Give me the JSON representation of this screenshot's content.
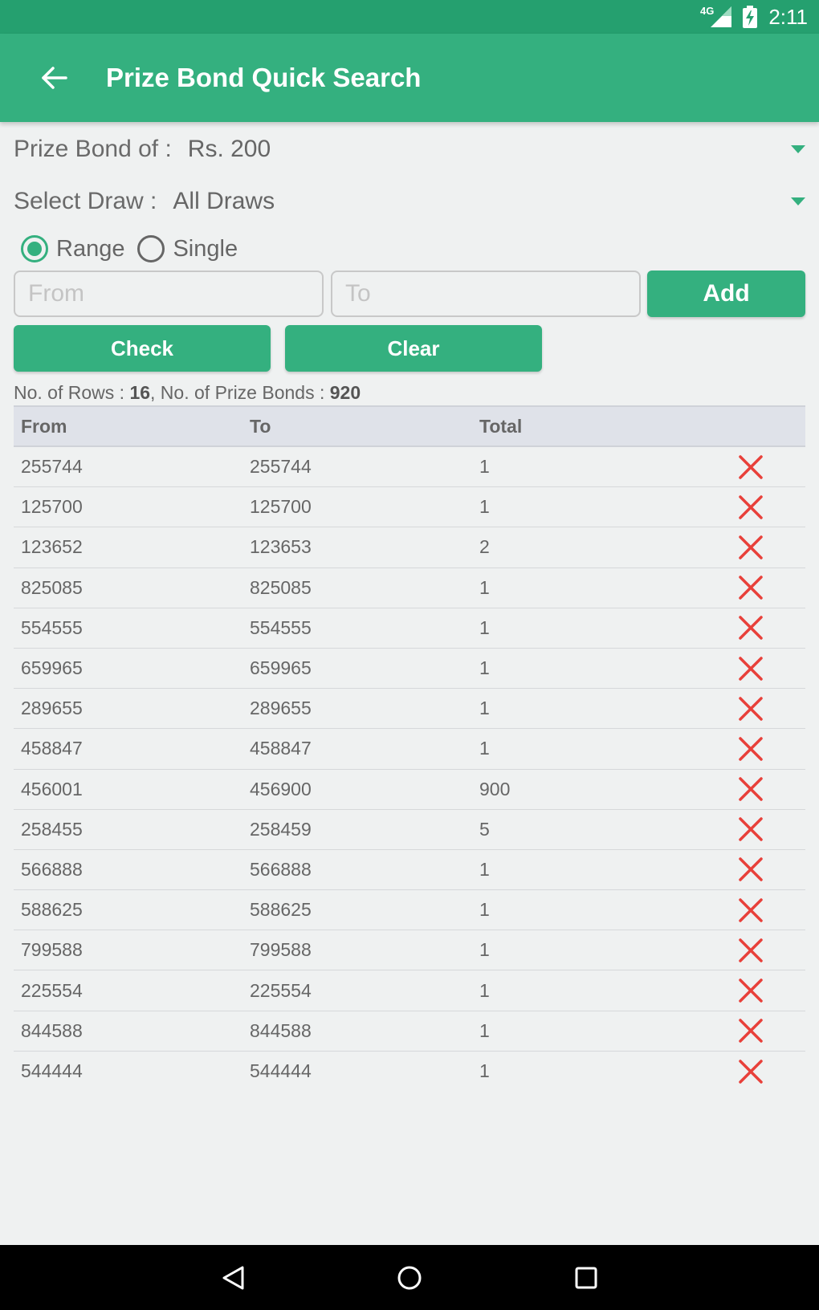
{
  "status_bar": {
    "network": "4G",
    "time": "2:11"
  },
  "app_bar": {
    "title": "Prize Bond Quick Search"
  },
  "prize_bond": {
    "label": "Prize Bond of :",
    "value": "Rs. 200"
  },
  "draw": {
    "label": "Select Draw :",
    "value": "All Draws"
  },
  "mode": {
    "range_label": "Range",
    "single_label": "Single",
    "selected": "Range"
  },
  "inputs": {
    "from_placeholder": "From",
    "to_placeholder": "To",
    "from_value": "",
    "to_value": ""
  },
  "buttons": {
    "add": "Add",
    "check": "Check",
    "clear": "Clear"
  },
  "summary": {
    "rows_label": "No. of Rows :",
    "rows": "16",
    "bonds_label": ", No. of Prize Bonds :",
    "bonds": "920"
  },
  "table": {
    "headers": {
      "from": "From",
      "to": "To",
      "total": "Total"
    },
    "rows": [
      {
        "from": "255744",
        "to": "255744",
        "total": "1"
      },
      {
        "from": "125700",
        "to": "125700",
        "total": "1"
      },
      {
        "from": "123652",
        "to": "123653",
        "total": "2"
      },
      {
        "from": "825085",
        "to": "825085",
        "total": "1"
      },
      {
        "from": "554555",
        "to": "554555",
        "total": "1"
      },
      {
        "from": "659965",
        "to": "659965",
        "total": "1"
      },
      {
        "from": "289655",
        "to": "289655",
        "total": "1"
      },
      {
        "from": "458847",
        "to": "458847",
        "total": "1"
      },
      {
        "from": "456001",
        "to": "456900",
        "total": "900"
      },
      {
        "from": "258455",
        "to": "258459",
        "total": "5"
      },
      {
        "from": "566888",
        "to": "566888",
        "total": "1"
      },
      {
        "from": "588625",
        "to": "588625",
        "total": "1"
      },
      {
        "from": "799588",
        "to": "799588",
        "total": "1"
      },
      {
        "from": "225554",
        "to": "225554",
        "total": "1"
      },
      {
        "from": "844588",
        "to": "844588",
        "total": "1"
      },
      {
        "from": "544444",
        "to": "544444",
        "total": "1"
      }
    ]
  },
  "colors": {
    "primary": "#34b07f",
    "primary_dark": "#25a06f",
    "delete": "#e8403a"
  }
}
